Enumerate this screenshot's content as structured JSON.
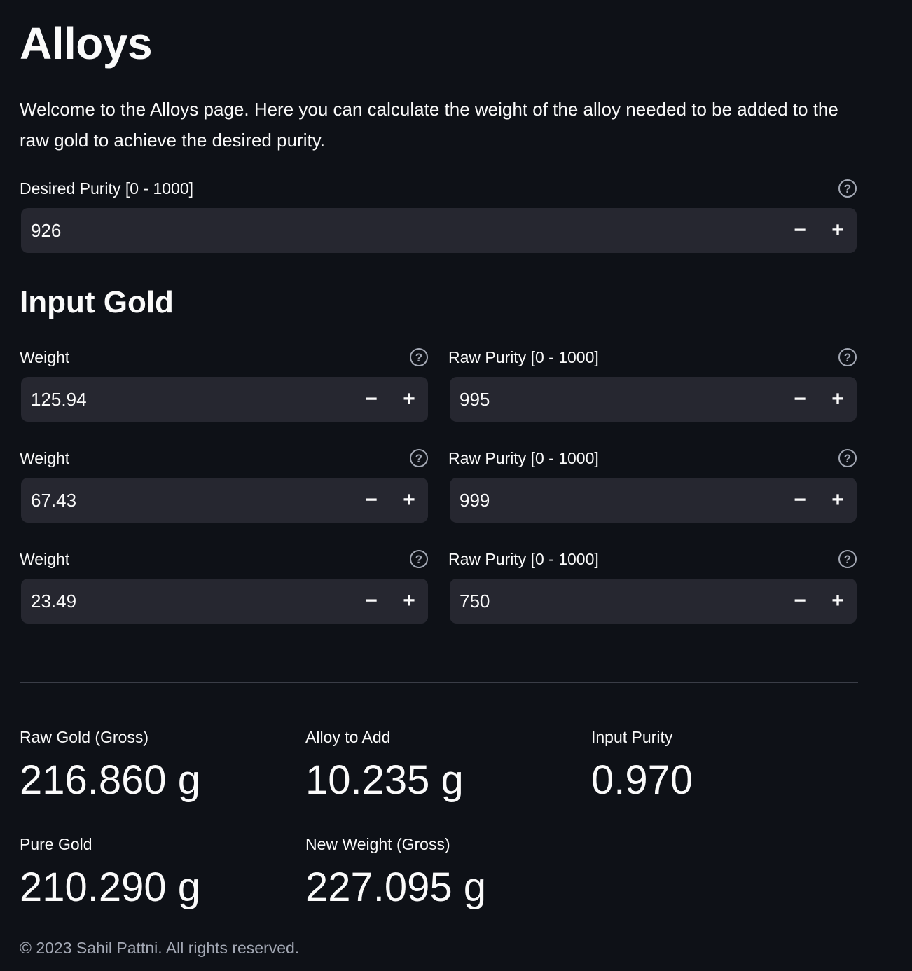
{
  "page": {
    "title": "Alloys",
    "intro": "Welcome to the Alloys page. Here you can calculate the weight of the alloy needed to be added to the raw gold to achieve the desired purity."
  },
  "desired_purity": {
    "label": "Desired Purity [0 - 1000]",
    "value": "926"
  },
  "input_gold": {
    "heading": "Input Gold",
    "rows": [
      {
        "weight_label": "Weight",
        "weight": "125.94",
        "purity_label": "Raw Purity [0 - 1000]",
        "purity": "995"
      },
      {
        "weight_label": "Weight",
        "weight": "67.43",
        "purity_label": "Raw Purity [0 - 1000]",
        "purity": "999"
      },
      {
        "weight_label": "Weight",
        "weight": "23.49",
        "purity_label": "Raw Purity [0 - 1000]",
        "purity": "750"
      }
    ]
  },
  "controls": {
    "minus": "−",
    "plus": "+",
    "help": "?"
  },
  "metrics": {
    "raw_gold": {
      "label": "Raw Gold (Gross)",
      "value": "216.860 g"
    },
    "alloy_to_add": {
      "label": "Alloy to Add",
      "value": "10.235 g"
    },
    "input_purity": {
      "label": "Input Purity",
      "value": "0.970"
    },
    "pure_gold": {
      "label": "Pure Gold",
      "value": "210.290 g"
    },
    "new_weight": {
      "label": "New Weight (Gross)",
      "value": "227.095 g"
    }
  },
  "footer": "© 2023 Sahil Pattni. All rights reserved."
}
